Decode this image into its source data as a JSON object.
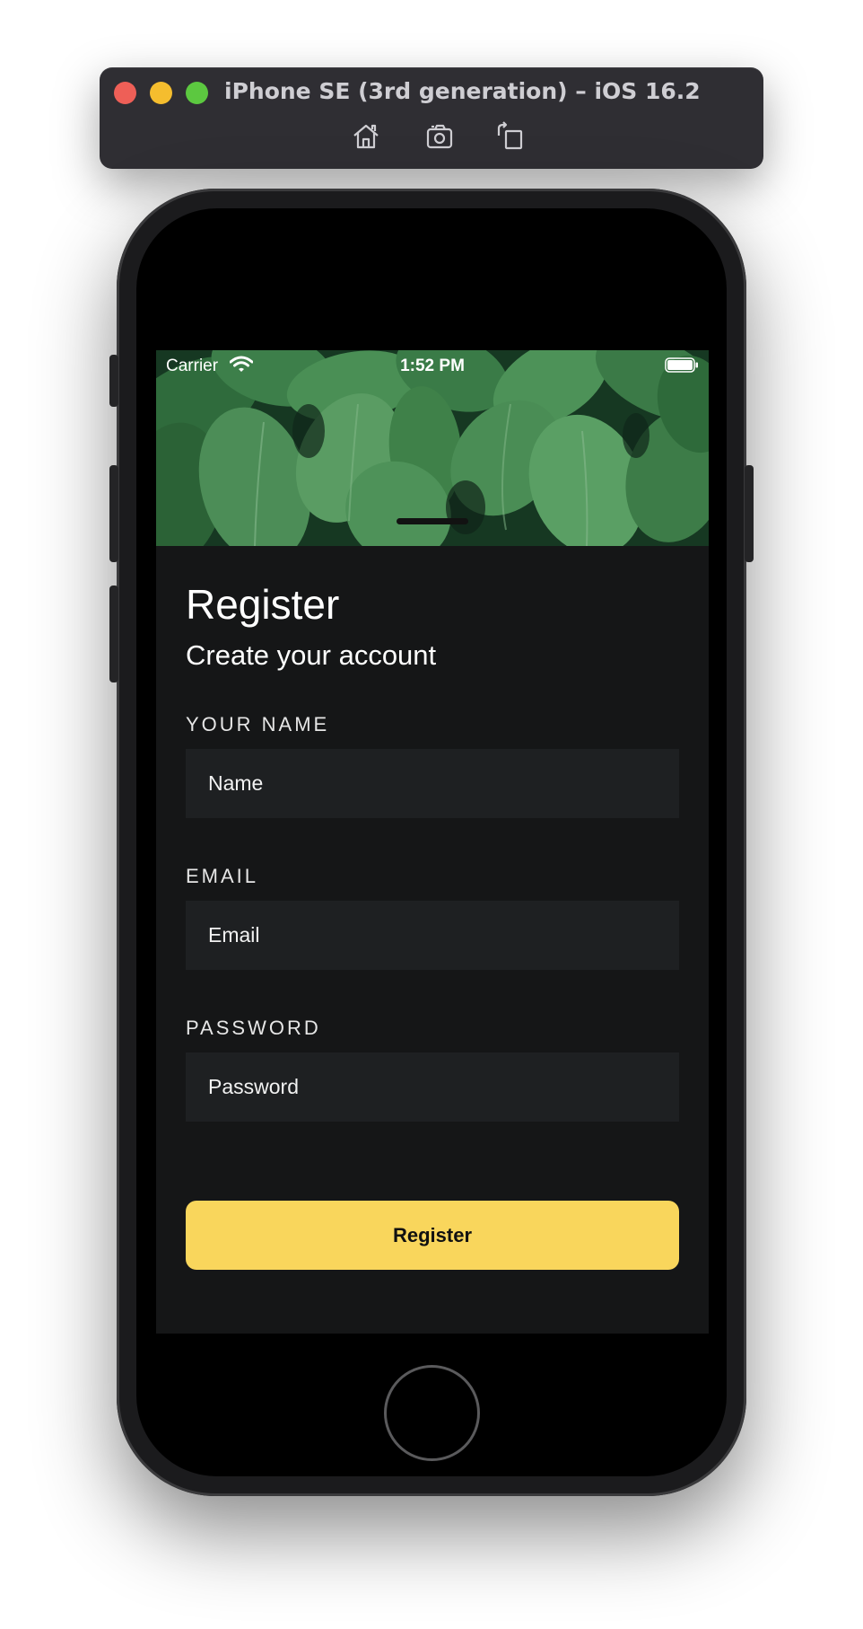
{
  "simulator": {
    "title": "iPhone SE (3rd generation) – iOS 16.2",
    "tools": [
      "home-icon",
      "screenshot-icon",
      "rotate-icon"
    ]
  },
  "status_bar": {
    "carrier": "Carrier",
    "time": "1:52 PM"
  },
  "page": {
    "title": "Register",
    "subtitle": "Create your account"
  },
  "form": {
    "name_label": "YOUR NAME",
    "name_placeholder": "Name",
    "email_label": "EMAIL",
    "email_placeholder": "Email",
    "password_label": "PASSWORD",
    "password_placeholder": "Password",
    "submit_label": "Register"
  },
  "colors": {
    "accent": "#f9d65c",
    "background": "#151617",
    "field_background": "#1e2022"
  }
}
